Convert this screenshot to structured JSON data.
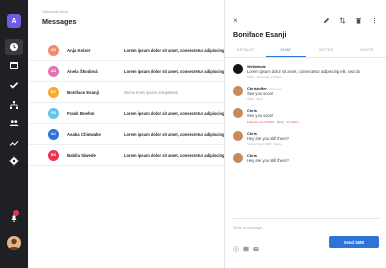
{
  "rail": {
    "brand": "A",
    "colors": {
      "background": "#1f2024",
      "brand": "#6f5ce6",
      "active": "#3a3b40",
      "badge": "#e8344e"
    },
    "nav_icons": [
      "clock-icon",
      "calendar-icon",
      "check-icon",
      "sitemap-icon",
      "people-icon",
      "trend-icon",
      "gear-icon"
    ]
  },
  "main": {
    "breadcrumb": "Voicemail inbox",
    "title": "Messages",
    "rows": [
      {
        "initials": "AK",
        "color": "#f08c6c",
        "name": "Anja Keizer",
        "preview": "Lorem ipsum dolor sit amet, consectetur adipiscing",
        "unread": true
      },
      {
        "initials": "AS",
        "color": "#e671b0",
        "name": "Anela Škodová",
        "preview": "Lorem ipsum dolor sit amet, consectetur adipiscing",
        "unread": true
      },
      {
        "initials": "BC",
        "color": "#f6a92c",
        "name": "Boniface Esanji",
        "preview": "Nemo enim ipsam voluptatem",
        "unread": false
      },
      {
        "initials": "FB",
        "color": "#64c4ea",
        "name": "Frank Boehm",
        "preview": "Lorem ipsum dolor sit amet, consectetur adipiscing",
        "unread": true
      },
      {
        "initials": "AC",
        "color": "#2f73d8",
        "name": "Asaka Chinwake",
        "preview": "Lorem ipsum dolor sit amet, consectetur adipiscing",
        "unread": true
      },
      {
        "initials": "BS",
        "color": "#e8344e",
        "name": "Babila Siwede",
        "preview": "Lorem ipsum dolor sit amet, consectetur adipiscing",
        "unread": true
      }
    ]
  },
  "panel": {
    "close": "×",
    "contact": "Boniface Esanji",
    "tabs": [
      {
        "label": "DETAILS",
        "active": false
      },
      {
        "label": "CHAT",
        "active": true
      },
      {
        "label": "NOTES",
        "active": false
      },
      {
        "label": "VISITS",
        "active": false
      }
    ],
    "messages": [
      {
        "sender": "Wellwinde",
        "stamp": "",
        "body": "Lorem ipsum dolor sit amet, consectetur adipiscing elit, sed do",
        "meta": "SMS · Yesterday 1:34am",
        "error": false,
        "avatar": "#141414"
      },
      {
        "sender": "Christoffer",
        "stamp": "Just now",
        "body": "See you soon!",
        "meta": "SMS · Sent",
        "error": false,
        "avatar": "#c98a5a"
      },
      {
        "sender": "Chris",
        "stamp": "",
        "body": "See you soon!",
        "meta": "Failed to send SMS · Retry · 11:33am",
        "error": true,
        "avatar": "#c98a5a"
      },
      {
        "sender": "Chris",
        "stamp": "",
        "body": "Hey are you still there?",
        "meta": "Sent to Sent SMS · Seen",
        "error": false,
        "avatar": "#c98a5a"
      },
      {
        "sender": "Chris",
        "stamp": "",
        "body": "Hey are you still there?",
        "meta": "",
        "error": false,
        "avatar": "#c98a5a"
      }
    ],
    "composer_placeholder": "Write a message...",
    "send_label": "Send SMS",
    "accent": "#2f73d8",
    "error_color": "#e24b4b"
  }
}
